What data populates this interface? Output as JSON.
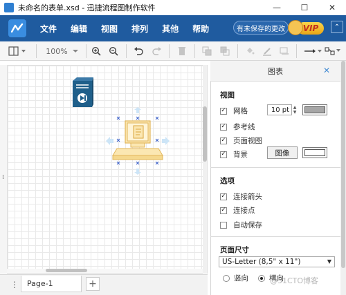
{
  "window": {
    "title": "未命名的表单.xsd - 迅捷流程图制作软件",
    "controls": {
      "minimize": "—",
      "maximize": "☐",
      "close": "✕"
    }
  },
  "menubar": {
    "items": [
      "文件",
      "编辑",
      "视图",
      "排列",
      "其他",
      "帮助"
    ],
    "unsaved_label": "有未保存的更改",
    "vip_label": "VIP",
    "collapse_icon": "⌃"
  },
  "toolbar": {
    "zoom": "100%",
    "icons": [
      "format-panel-icon",
      "zoom-in-icon",
      "zoom-out-icon",
      "undo-icon",
      "redo-icon",
      "delete-icon",
      "to-front-icon",
      "to-back-icon",
      "fill-color-icon",
      "line-color-icon",
      "shadow-icon",
      "connection-icon",
      "waypoints-icon"
    ]
  },
  "bottom": {
    "page_tab": "Page-1",
    "add_page": "+",
    "menu": "⋮"
  },
  "panel": {
    "title": "图表",
    "close": "✕",
    "view": {
      "heading": "视图",
      "grid": {
        "label": "网格",
        "checked": true,
        "size": "10 pt",
        "color": "#a6a6a6"
      },
      "guides": {
        "label": "参考线",
        "checked": true
      },
      "page_view": {
        "label": "页面视图",
        "checked": true
      },
      "background": {
        "label": "背景",
        "checked": true,
        "button": "图像",
        "color": "#ffffff"
      }
    },
    "options": {
      "heading": "选项",
      "connection_arrows": {
        "label": "连接箭头",
        "checked": true
      },
      "connection_points": {
        "label": "连接点",
        "checked": true
      },
      "autosave": {
        "label": "自动保存",
        "checked": false
      }
    },
    "page_size": {
      "heading": "页面尺寸",
      "selected": "US-Letter (8,5\" x 11\")",
      "portrait": "竖向",
      "landscape": "横向",
      "orientation": "landscape"
    }
  },
  "watermark": "@51CTO博客",
  "colors": {
    "menubar": "#1f5b9f",
    "accent": "#2f7fd1",
    "shape_fill": "#fbe7b2",
    "shape_stroke": "#e2b659",
    "server_fill": "#1f5f8a"
  }
}
